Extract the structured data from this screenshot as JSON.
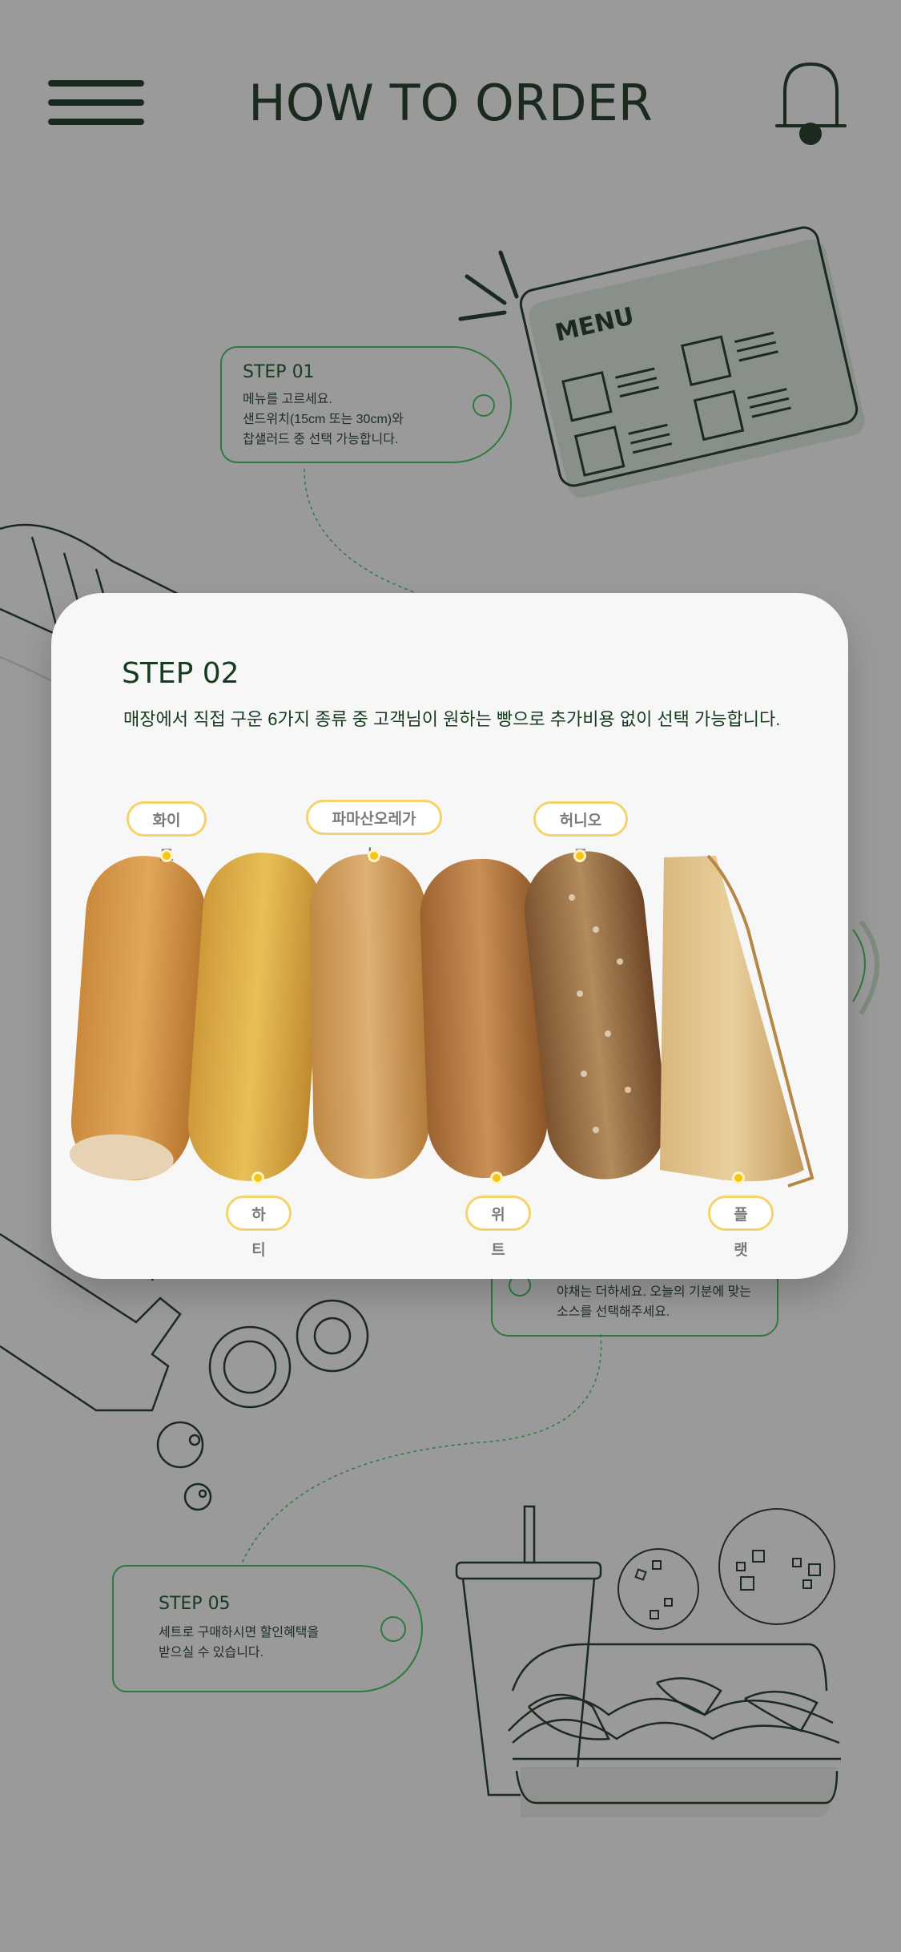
{
  "header": {
    "title": "HOW TO ORDER",
    "menu_icon": "hamburger-menu-icon",
    "bell_icon": "bell-icon"
  },
  "menu_board": {
    "label": "MENU"
  },
  "steps": {
    "step01": {
      "title": "STEP 01",
      "desc": "메뉴를 고르세요.\n샌드위치(15cm 또는 30cm)와\n찹샐러드 중 선택 가능합니다."
    },
    "step04": {
      "desc": "야채는 더하세요. 오늘의 기분에 맞는\n소스를 선택해주세요."
    },
    "step05": {
      "title": "STEP 05",
      "desc": "세트로 구매하시면 할인혜택을\n받으실 수 있습니다."
    }
  },
  "modal": {
    "title": "STEP 02",
    "desc": "매장에서 직접 구운 6가지 종류 중 고객님이 원하는 빵으로 추가비용 없이 선택 가능합니다.",
    "breads": [
      {
        "name": "화이트"
      },
      {
        "name": "하티"
      },
      {
        "name": "파마산오레가노"
      },
      {
        "name": "위트"
      },
      {
        "name": "허니오트"
      },
      {
        "name": "플랫"
      }
    ]
  },
  "colors": {
    "background": "#9a9a9a",
    "accent_green": "#2f7a3e",
    "label_yellow": "#f3d36a"
  }
}
